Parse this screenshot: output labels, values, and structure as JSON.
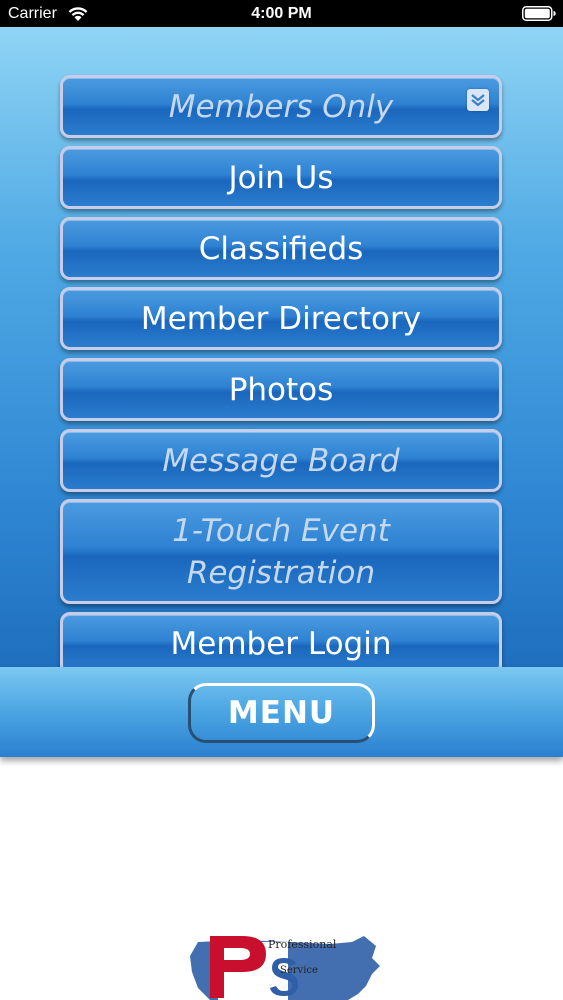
{
  "status_bar": {
    "carrier": "Carrier",
    "time": "4:00 PM",
    "wifi_icon": "wifi-icon",
    "battery_icon": "battery-icon"
  },
  "menu": {
    "items": [
      {
        "label": "Members Only",
        "enabled": false,
        "has_expand_icon": true
      },
      {
        "label": "Join Us",
        "enabled": true
      },
      {
        "label": "Classifieds",
        "enabled": true
      },
      {
        "label": "Member Directory",
        "enabled": true
      },
      {
        "label": "Photos",
        "enabled": true
      },
      {
        "label": "Message Board",
        "enabled": false
      },
      {
        "label_line1": "1-Touch Event",
        "label_line2": "Registration",
        "enabled": false
      },
      {
        "label": "Member Login",
        "enabled": true
      }
    ],
    "expand_icon": "chevron-double-down-icon"
  },
  "menu_bar": {
    "button_label": "MENU"
  },
  "logo": {
    "text_top": "Professional",
    "text_bottom": "Service",
    "icon": "usa-map-logo"
  },
  "colors": {
    "panel_top": "#8fd4f5",
    "panel_bottom": "#1f6fbe",
    "button_border": "#c7cde8",
    "disabled_text": "#c6d8ee",
    "logo_red": "#c8102e",
    "logo_blue": "#2f5fa8"
  }
}
